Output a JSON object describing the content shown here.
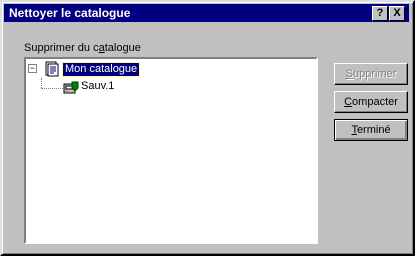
{
  "window": {
    "title": "Nettoyer le catalogue"
  },
  "titlebar_buttons": {
    "help": "?",
    "close": "X"
  },
  "group": {
    "label_pre": "Supprimer du c",
    "label_accel": "a",
    "label_post": "talogue"
  },
  "tree": {
    "expander": "−",
    "root": {
      "label": "Mon catalogue",
      "icon": "catalog-document-icon",
      "selected": true
    },
    "children": [
      {
        "label": "Sauv.1",
        "icon": "backup-set-icon"
      }
    ]
  },
  "buttons": {
    "delete": {
      "accel": "S",
      "rest": "upprimer",
      "enabled": false
    },
    "compact": {
      "accel": "C",
      "rest": "ompacter",
      "enabled": true
    },
    "done": {
      "accel": "T",
      "rest": "erminé",
      "enabled": true,
      "default": true
    }
  },
  "colors": {
    "titlebar": "#000080",
    "face": "#c0c0c0",
    "selection": "#000080"
  }
}
